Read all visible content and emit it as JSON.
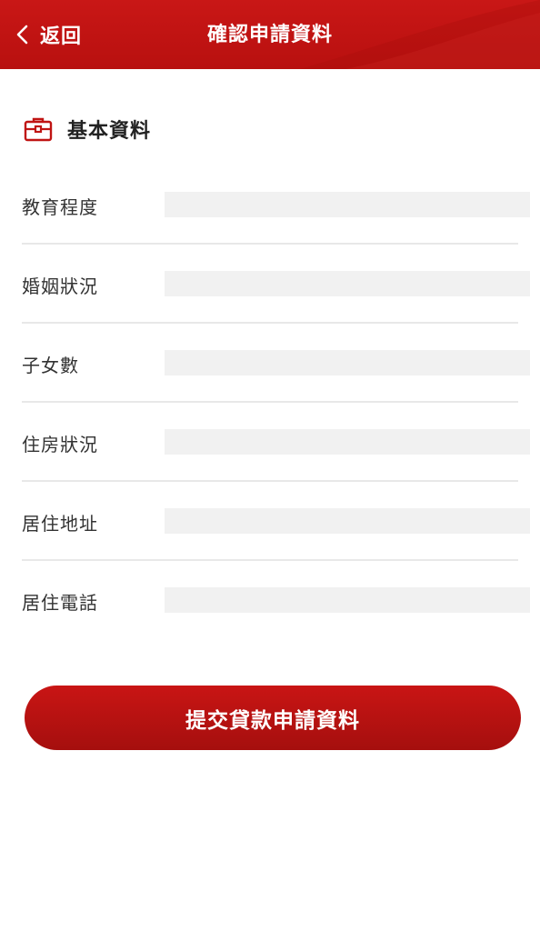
{
  "header": {
    "back_label": "返回",
    "title": "確認申請資料",
    "back_icon": "chevron-left-icon"
  },
  "section": {
    "title": "基本資料",
    "icon": "briefcase-icon"
  },
  "form": {
    "fields": [
      {
        "label": "教育程度",
        "value": ""
      },
      {
        "label": "婚姻狀況",
        "value": ""
      },
      {
        "label": "子女數",
        "value": ""
      },
      {
        "label": "住房狀況",
        "value": ""
      },
      {
        "label": "居住地址",
        "value": ""
      },
      {
        "label": "居住電話",
        "value": ""
      }
    ]
  },
  "submit": {
    "label": "提交貸款申請資料"
  },
  "colors": {
    "brand_red": "#c01413",
    "input_bg": "#f1f1f1",
    "divider": "#e8e8e8"
  }
}
